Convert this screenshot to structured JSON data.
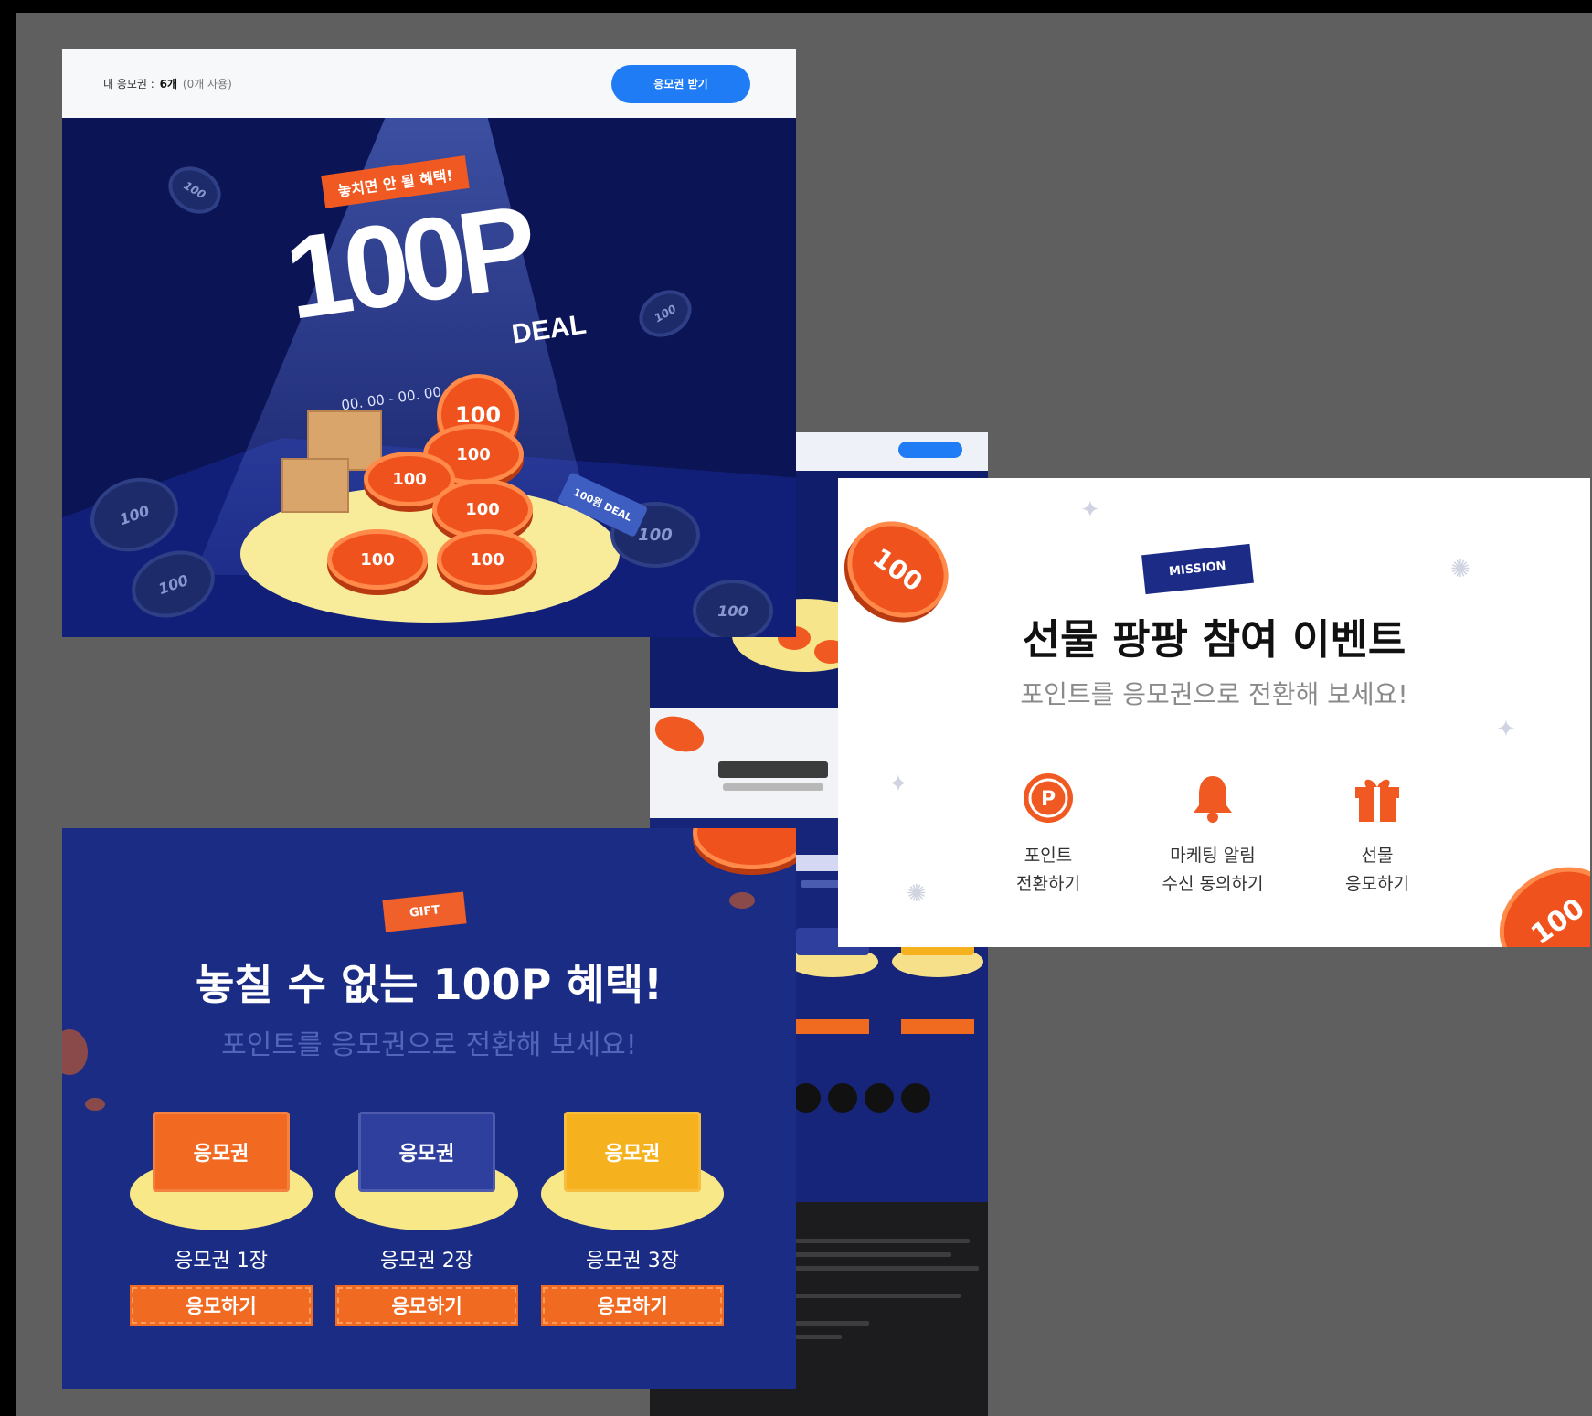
{
  "colors": {
    "canvas": "#5f5f5f",
    "navy": "#0b1454",
    "gift_blue": "#1b2c84",
    "accent_orange": "#f05a22",
    "accent_blue_button": "#1f7cf5",
    "spot_yellow": "#f8ec9b"
  },
  "deal_card": {
    "topbar": {
      "label": "내 응모권 :",
      "count": "6개",
      "used": "(0개 사용)",
      "button_label": "응모권 받기"
    },
    "ribbon": "놓치면 안 될 혜택!",
    "headline": "100P",
    "headline_suffix": "DEAL",
    "date_range": "00. 00 - 00. 00",
    "price_tag": "100원 DEAL",
    "coin_value": "100"
  },
  "mission_card": {
    "tag": "MISSION",
    "title": "선물 팡팡 참여 이벤트",
    "subtitle": "포인트를 응모권으로 전환해 보세요!",
    "steps": [
      {
        "icon": "point-coin-icon",
        "label": "포인트\n전환하기"
      },
      {
        "icon": "bell-icon",
        "label": "마케팅 알림\n수신 동의하기"
      },
      {
        "icon": "gift-icon",
        "label": "선물\n응모하기"
      }
    ],
    "coin_value": "100"
  },
  "gift_card": {
    "tag": "GIFT",
    "title": "놓칠 수 없는 100P 혜택!",
    "subtitle": "포인트를 응모권으로 전환해 보세요!",
    "tickets": [
      {
        "voucher_label": "응모권",
        "count_label": "응모권 1장",
        "button_label": "응모하기",
        "color": "#f26a21"
      },
      {
        "voucher_label": "응모권",
        "count_label": "응모권 2장",
        "button_label": "응모하기",
        "color": "#2f3f9e"
      },
      {
        "voucher_label": "응모권",
        "count_label": "응모권 3장",
        "button_label": "응모하기",
        "color": "#f6b21e"
      }
    ]
  }
}
